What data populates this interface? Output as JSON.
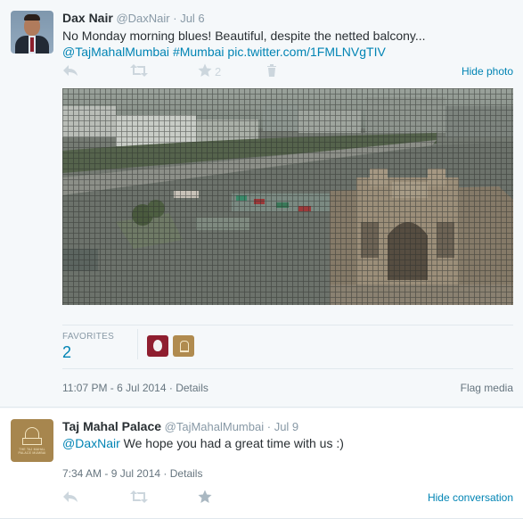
{
  "tweet1": {
    "name": "Dax Nair",
    "handle": "@DaxNair",
    "separator": "·",
    "date": "Jul 6",
    "text": "No Monday morning blues! Beautiful, despite the netted balcony...",
    "mentions": "@TajMahalMumbai",
    "hashtag": "#Mumbai",
    "pic_link": "pic.twitter.com/1FMLNVgTIV",
    "actions": {
      "reply_icon": "reply-icon",
      "retweet_icon": "retweet-icon",
      "favorite_icon": "star-icon",
      "favorite_count": "2",
      "delete_icon": "trash-icon"
    },
    "hide_photo_label": "Hide photo",
    "favorites_label": "FAVORITES",
    "favorites_count": "2",
    "timestamp": "11:07 PM - 6 Jul 2014",
    "details_label": "Details",
    "flag_label": "Flag media"
  },
  "tweet2": {
    "name": "Taj Mahal Palace",
    "handle": "@TajMahalMumbai",
    "separator": "·",
    "date": "Jul 9",
    "mention": "@DaxNair",
    "text": " We hope you had  a great time with us :)",
    "timestamp": "7:34 AM - 9 Jul 2014",
    "details_label": "Details",
    "hide_conversation_label": "Hide conversation",
    "avatar_text": "THE TAJ MAHAL PALACE MUMBAI"
  },
  "colors": {
    "link": "#0084b4",
    "muted": "#8899a6",
    "action_icon": "#ccd6dd",
    "background": "#f5f8fa"
  }
}
